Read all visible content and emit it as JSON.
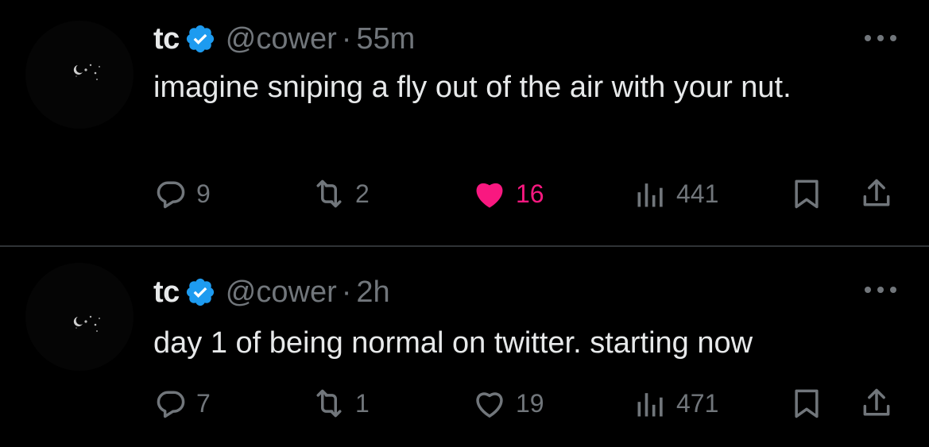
{
  "colors": {
    "background": "#000000",
    "text": "#e7e9ea",
    "secondary": "#71767b",
    "verified": "#1d9bf0",
    "like_active": "#f91880",
    "divider": "#2f3336"
  },
  "tweets": [
    {
      "author": {
        "name": "tc",
        "handle": "@cower",
        "verified": true
      },
      "separator": "·",
      "time": "55m",
      "text": "imagine sniping a fly out of the air with your nut.",
      "replies": "9",
      "retweets": "2",
      "likes": "16",
      "liked": true,
      "views": "441"
    },
    {
      "author": {
        "name": "tc",
        "handle": "@cower",
        "verified": true
      },
      "separator": "·",
      "time": "2h",
      "text": "day 1 of being normal on twitter. starting now",
      "replies": "7",
      "retweets": "1",
      "likes": "19",
      "liked": false,
      "views": "471"
    }
  ],
  "icons": {
    "reply": "reply-icon",
    "retweet": "retweet-icon",
    "like": "heart-icon",
    "views": "views-icon",
    "bookmark": "bookmark-icon",
    "share": "share-icon",
    "more": "more-icon",
    "verified": "verified-badge-icon"
  }
}
